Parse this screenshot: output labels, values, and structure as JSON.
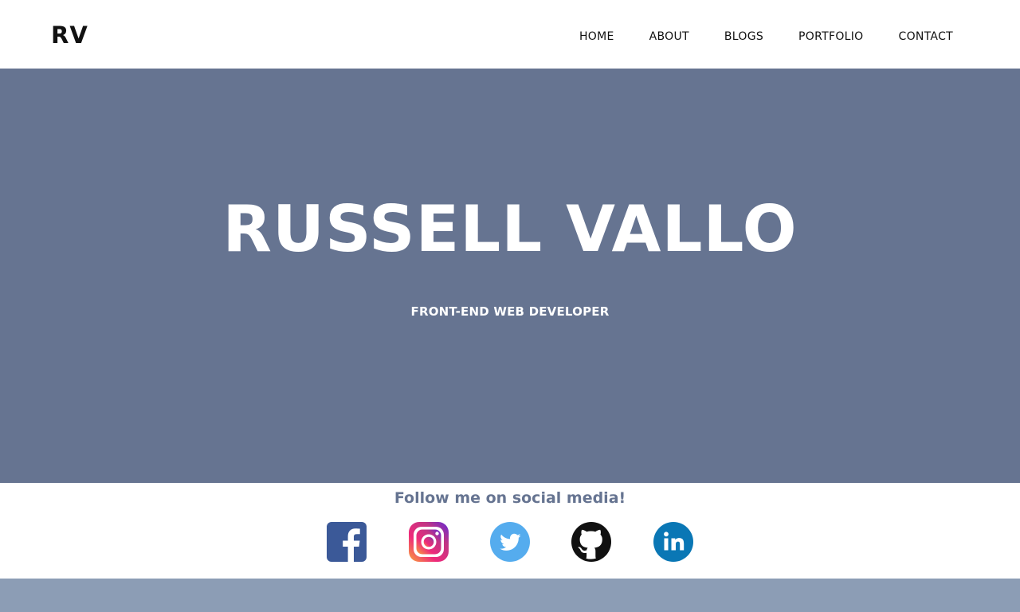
{
  "header": {
    "logo": "RV",
    "nav": [
      {
        "label": "HOME"
      },
      {
        "label": "ABOUT"
      },
      {
        "label": "BLOGS"
      },
      {
        "label": "PORTFOLIO"
      },
      {
        "label": "CONTACT"
      }
    ]
  },
  "hero": {
    "name": "RUSSELL VALLO",
    "role": "FRONT-END WEB DEVELOPER",
    "background": "#667491"
  },
  "social": {
    "heading": "Follow me on social media!",
    "icons": [
      {
        "name": "facebook-icon",
        "color": "#3b5998"
      },
      {
        "name": "instagram-icon",
        "color": "#c13584"
      },
      {
        "name": "twitter-icon",
        "color": "#55acee"
      },
      {
        "name": "github-icon",
        "color": "#111111"
      },
      {
        "name": "linkedin-icon",
        "color": "#0a77b5"
      }
    ]
  },
  "colors": {
    "accent": "#667491",
    "footer_strip": "#8c9db5"
  }
}
